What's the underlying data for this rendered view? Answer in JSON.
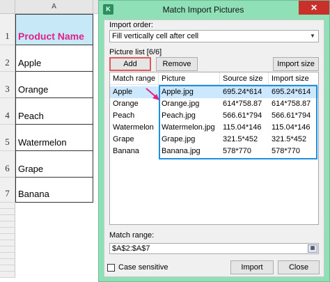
{
  "sheet": {
    "column_header": "A",
    "row_numbers": [
      "1",
      "2",
      "3",
      "4",
      "5",
      "6",
      "7"
    ],
    "cells": [
      "Product Name",
      "Apple",
      "Orange",
      "Peach",
      "Watermelon",
      "Grape",
      "Banana"
    ]
  },
  "dialog": {
    "title": "Match Import Pictures",
    "close_label": "✕",
    "import_order_label": "Import order:",
    "import_order_value": "Fill vertically cell after cell",
    "picture_list_label": "Picture list [6/6]",
    "add_label": "Add",
    "remove_label": "Remove",
    "import_size_label": "Import size",
    "columns": [
      "Match range",
      "Picture",
      "Source size",
      "Import size"
    ],
    "rows": [
      {
        "match": "Apple",
        "picture": "Apple.jpg",
        "source": "695.24*614",
        "import": "695.24*614"
      },
      {
        "match": "Orange",
        "picture": "Orange.jpg",
        "source": "614*758.87",
        "import": "614*758.87"
      },
      {
        "match": "Peach",
        "picture": "Peach.jpg",
        "source": "566.61*794",
        "import": "566.61*794"
      },
      {
        "match": "Watermelon",
        "picture": "Watermelon.jpg",
        "source": "115.04*146",
        "import": "115.04*146"
      },
      {
        "match": "Grape",
        "picture": "Grape.jpg",
        "source": "321.5*452",
        "import": "321.5*452"
      },
      {
        "match": "Banana",
        "picture": "Banana.jpg",
        "source": "578*770",
        "import": "578*770"
      }
    ],
    "match_range_label": "Match range:",
    "match_range_value": "$A$2:$A$7",
    "case_sensitive_label": "Case sensitive",
    "import_button_label": "Import",
    "close_button_label": "Close"
  },
  "colors": {
    "dialog_bg": "#8fe0b7",
    "header_cell_bg": "#c6e8f7",
    "header_text": "#e0218a",
    "highlight_red": "#e05858",
    "highlight_blue": "#1e90e0",
    "selected_row": "#cce8ff"
  }
}
